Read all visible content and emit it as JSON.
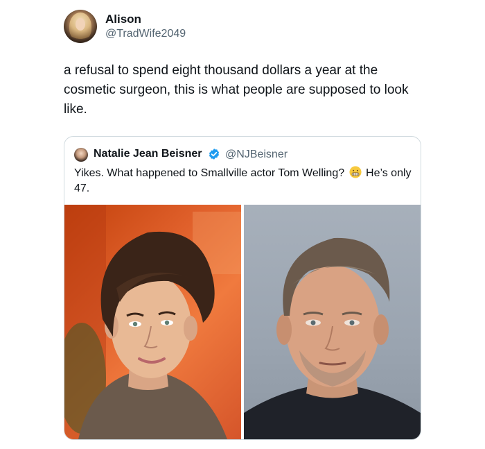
{
  "tweet": {
    "author": {
      "name": "Alison",
      "handle": "@TradWife2049"
    },
    "text": "a refusal to spend eight thousand dollars a year at the cosmetic surgeon, this is what people are supposed to look like."
  },
  "quote": {
    "author": {
      "name": "Natalie Jean Beisner",
      "handle": "@NJBeisner",
      "verified": true
    },
    "text_before_emoji": "Yikes. What happened to Smallville actor Tom Welling?",
    "emoji": "grimacing-face",
    "text_after_emoji": "He’s only 47.",
    "media": [
      {
        "name": "young-portrait-photo"
      },
      {
        "name": "mugshot-photo"
      }
    ]
  },
  "colors": {
    "text_primary": "#0f1419",
    "text_secondary": "#536471",
    "border": "#cfd9de",
    "verified_blue": "#1d9bf0"
  }
}
